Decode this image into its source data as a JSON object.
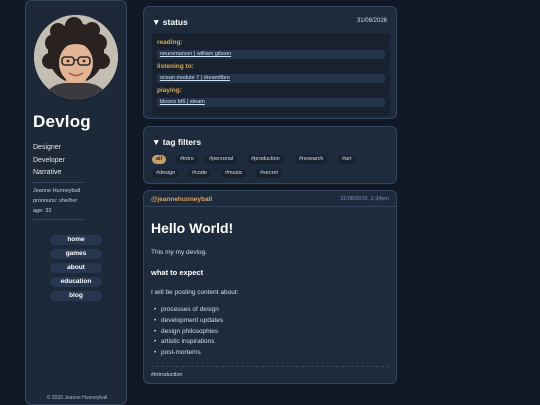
{
  "sidebar": {
    "brand": "Devlog",
    "roles": [
      "Designer",
      "Developer",
      "Narrative"
    ],
    "name": "Jeanne Hunneyball",
    "pronouns": "pronouns: she/her",
    "age": "age: 33",
    "nav": [
      "home",
      "games",
      "about",
      "education",
      "blog"
    ],
    "footer": "© 2026 Jeanne Hunneyball"
  },
  "status": {
    "title": "status",
    "date": "31/08/2026",
    "toggle_icon": "triangle-down-icon",
    "items": [
      {
        "label": "reading:",
        "value": "neuromancer | william gibson"
      },
      {
        "label": "listening to:",
        "value": "ocean module 7 | dreamfibre"
      },
      {
        "label": "playing:",
        "value": "bloons td6 | steam"
      }
    ]
  },
  "tag_filters": {
    "title": "tag filters",
    "tags": [
      "all",
      "#intro",
      "#personal",
      "#production",
      "#research",
      "#art",
      "#design",
      "#code",
      "#music",
      "#secret"
    ],
    "active": "all"
  },
  "post": {
    "author": "@jeannehunneyball",
    "date": "31/08/2026, 2:34pm",
    "title": "Hello World!",
    "intro": "This my my devlog.",
    "heading": "what to expect",
    "lead": "I will be posting content about:",
    "bullets": [
      "processes of design",
      "development updates",
      "design philosophies",
      "artistic inspirations",
      "post-mortems"
    ],
    "tag": "#introduction"
  },
  "colors": {
    "background": "#111826",
    "panel": "#1e2b3c",
    "accent": "#d9a45a",
    "active_tag": "#c9a06a",
    "date_blue": "#6f8fb8"
  }
}
